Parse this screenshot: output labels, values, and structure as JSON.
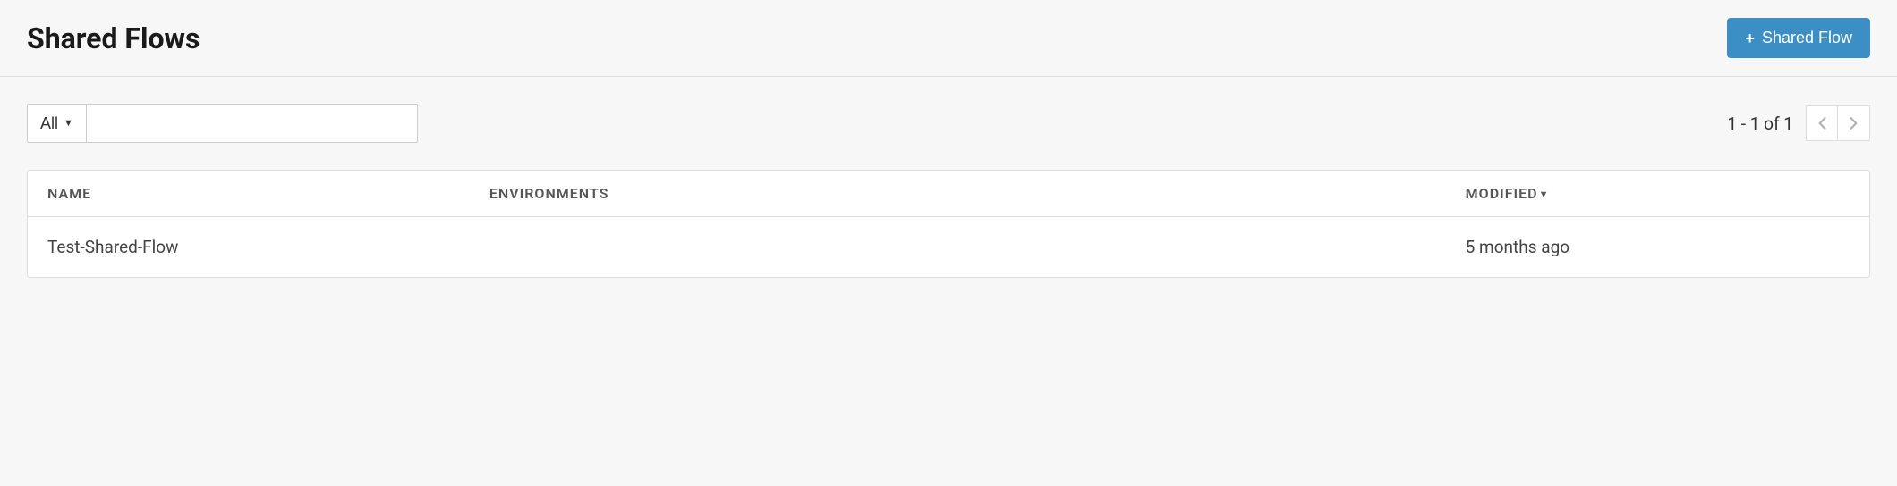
{
  "header": {
    "title": "Shared Flows",
    "add_button_label": "Shared Flow"
  },
  "filter": {
    "selected": "All",
    "search_value": ""
  },
  "pagination": {
    "range_text": "1 - 1 of 1"
  },
  "table": {
    "columns": {
      "name": "NAME",
      "environments": "ENVIRONMENTS",
      "modified": "MODIFIED"
    },
    "sort_indicator": "▼",
    "rows": [
      {
        "name": "Test-Shared-Flow",
        "environments": "",
        "modified": "5 months ago"
      }
    ]
  }
}
